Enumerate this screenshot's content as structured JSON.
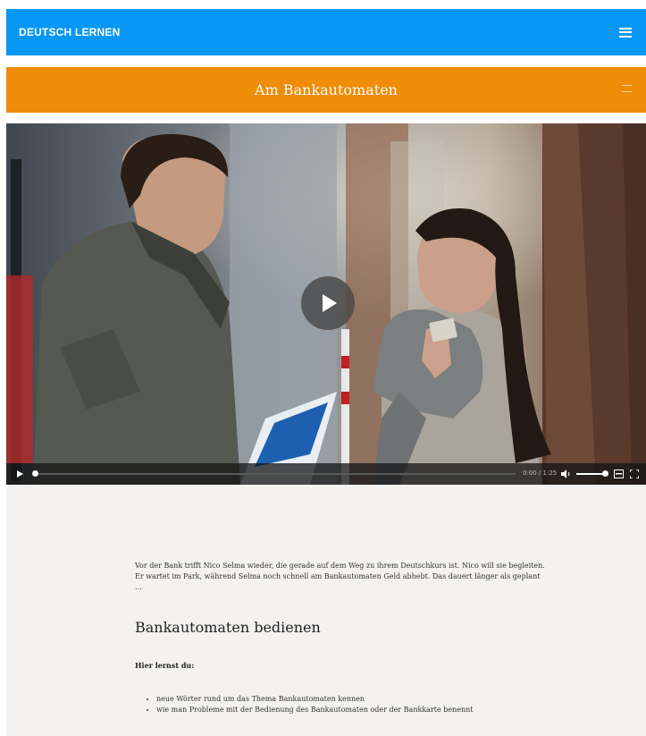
{
  "header": {
    "brand": "DEUTSCH LERNEN",
    "menu_icon": "hamburger-icon"
  },
  "lesson": {
    "title": "Am Bankautomaten",
    "menu_icon": "lines-icon"
  },
  "video": {
    "time": "0:00 / 1:25",
    "progress": 0,
    "volume": 0.9,
    "icons": [
      "play-icon",
      "volume-icon",
      "captions-icon",
      "fullscreen-icon"
    ]
  },
  "content": {
    "intro": "Vor der Bank trifft Nico Selma wieder, die gerade auf dem Weg zu ihrem Deutschkurs ist. Nico will sie begleiten. Er wartet im Park, während Selma noch schnell am Bankautomaten Geld abhebt. Das dauert länger als geplant …",
    "section_title": "Bankautomaten bedienen",
    "learn_heading": "Hier lernst du:",
    "goals": [
      "neue Wörter rund um das Thema Bankautomaten kennen",
      "wie man Probleme mit der Bedienung des Bankautomaten oder der Bankkarte benennt"
    ]
  },
  "colors": {
    "header": "#0797f4",
    "lesson_bar": "#ef8c08",
    "content_bg": "#f3f2f0"
  }
}
